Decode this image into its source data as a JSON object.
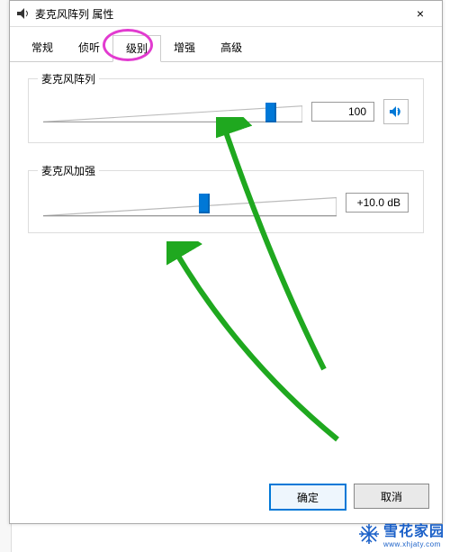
{
  "title": "麦克风阵列 属性",
  "close_glyph": "×",
  "tabs": {
    "t0": "常规",
    "t1": "侦听",
    "t2": "级别",
    "t3": "增强",
    "t4": "高级"
  },
  "group1": {
    "label": "麦克风阵列",
    "value": "100",
    "slider_pos": 0.88
  },
  "group2": {
    "label": "麦克风加强",
    "value": "+10.0 dB",
    "slider_pos": 0.55
  },
  "buttons": {
    "ok": "确定",
    "cancel": "取消"
  },
  "watermark": {
    "main": "雪花家园",
    "sub": "www.xhjaty.com"
  }
}
